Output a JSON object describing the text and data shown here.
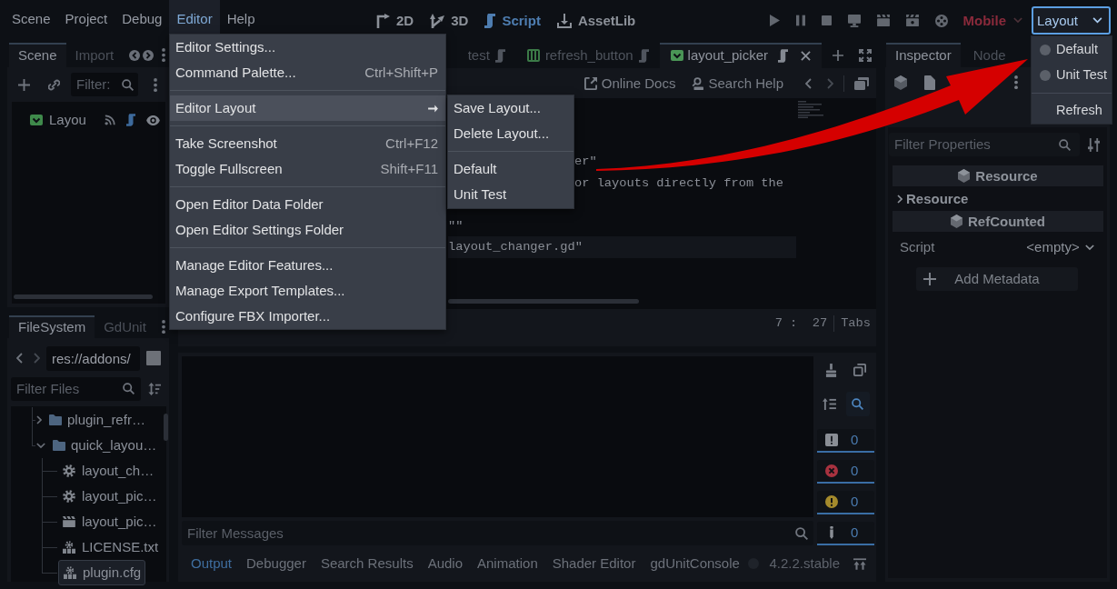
{
  "menu_bar": {
    "menus": [
      {
        "label": "Scene",
        "selected": false
      },
      {
        "label": "Project",
        "selected": false
      },
      {
        "label": "Debug",
        "selected": false
      },
      {
        "label": "Editor",
        "selected": true
      },
      {
        "label": "Help",
        "selected": false
      }
    ]
  },
  "main_screens": [
    {
      "label": "2D",
      "kind": "canvas",
      "selected": false
    },
    {
      "label": "3D",
      "kind": "spatial",
      "selected": false
    },
    {
      "label": "Script",
      "kind": "script",
      "selected": true
    },
    {
      "label": "AssetLib",
      "kind": "assetlib",
      "selected": false
    }
  ],
  "run_bar": {
    "renderer": "Mobile"
  },
  "layout_picker": {
    "value": "Layout",
    "options": [
      {
        "label": "Default",
        "selected": false
      },
      {
        "label": "Unit Test",
        "selected": false
      }
    ],
    "actions": [
      "Refresh"
    ]
  },
  "editor_menu": {
    "sections": [
      {
        "items": [
          {
            "label": "Editor Settings...",
            "selected": false
          },
          {
            "label": "Command Palette...",
            "shortcut": "Ctrl+Shift+P",
            "selected": false
          }
        ]
      },
      {
        "items": [
          {
            "label": "Editor Layout",
            "submenu": true,
            "selected": true
          }
        ]
      },
      {
        "items": [
          {
            "label": "Take Screenshot",
            "shortcut": "Ctrl+F12",
            "selected": false
          },
          {
            "label": "Toggle Fullscreen",
            "shortcut": "Shift+F11",
            "selected": false
          }
        ]
      },
      {
        "items": [
          {
            "label": "Open Editor Data Folder",
            "selected": false
          },
          {
            "label": "Open Editor Settings Folder",
            "selected": false
          }
        ]
      },
      {
        "items": [
          {
            "label": "Manage Editor Features...",
            "selected": false
          },
          {
            "label": "Manage Export Templates...",
            "selected": false
          },
          {
            "label": "Configure FBX Importer...",
            "selected": false
          }
        ]
      }
    ]
  },
  "layout_submenu": {
    "sections": [
      {
        "items": [
          {
            "label": "Save Layout...",
            "selected": false
          },
          {
            "label": "Delete Layout...",
            "selected": false
          }
        ]
      },
      {
        "items": [
          {
            "label": "Default",
            "selected": false
          },
          {
            "label": "Unit Test",
            "selected": false
          }
        ]
      }
    ]
  },
  "scene_dock": {
    "tabs": [
      {
        "label": "Scene",
        "selected": true
      },
      {
        "label": "Import",
        "selected": false
      }
    ],
    "filter": {
      "placeholder": "Filter:"
    },
    "tree": [
      {
        "label": "Layou"
      }
    ]
  },
  "filesystem_dock": {
    "tabs": [
      {
        "label": "FileSystem",
        "selected": true
      },
      {
        "label": "GdUnit",
        "selected": false
      }
    ],
    "path": "res://addons/",
    "filter": {
      "placeholder": "Filter Files"
    },
    "tree": [
      {
        "label": "plugin_refr…",
        "kind": "folder",
        "expanded": false,
        "selected": false
      },
      {
        "label": "quick_layou…",
        "kind": "folder",
        "expanded": true,
        "selected": false,
        "children": [
          {
            "label": "layout_ch…",
            "kind": "script",
            "selected": false
          },
          {
            "label": "layout_pic…",
            "kind": "script",
            "selected": false
          },
          {
            "label": "layout_pic…",
            "kind": "scene",
            "selected": false
          },
          {
            "label": "LICENSE.txt",
            "kind": "text",
            "selected": false
          },
          {
            "label": "plugin.cfg",
            "kind": "text",
            "selected": true
          }
        ]
      }
    ]
  },
  "script_editor": {
    "tabs": [
      {
        "label": "test",
        "kind": "script",
        "selected": false
      },
      {
        "label": "refresh_button",
        "kind": "container",
        "selected": false
      },
      {
        "label": "layout_picker",
        "kind": "option",
        "selected": true
      }
    ],
    "toolbar": [
      {
        "label": "Online Docs",
        "kind": "docs"
      },
      {
        "label": "Search Help",
        "kind": "help"
      }
    ],
    "code": [
      {
        "text": "er\"",
        "current": false
      },
      {
        "text": "or layouts directly from the",
        "current": false
      },
      {
        "text": "\"\"",
        "current": false
      },
      {
        "text": "layout_changer.gd\"",
        "current": true
      }
    ],
    "cursor": "7 :  27",
    "indent": "Tabs"
  },
  "output_panel": {
    "search_toggle": {
      "on": true
    },
    "counters": [
      {
        "kind": "log",
        "count": "0",
        "on": true
      },
      {
        "kind": "error",
        "count": "0",
        "on": true
      },
      {
        "kind": "warning",
        "count": "0",
        "on": true
      },
      {
        "kind": "editor",
        "count": "0",
        "on": true
      }
    ],
    "filter": {
      "placeholder": "Filter Messages"
    }
  },
  "bottom_panel": {
    "tabs": [
      {
        "label": "Output",
        "selected": true
      },
      {
        "label": "Debugger",
        "selected": false
      },
      {
        "label": "Search Results",
        "selected": false
      },
      {
        "label": "Audio",
        "selected": false
      },
      {
        "label": "Animation",
        "selected": false
      },
      {
        "label": "Shader Editor",
        "selected": false
      },
      {
        "label": "gdUnitConsole",
        "selected": false
      }
    ],
    "version": "4.2.2.stable"
  },
  "inspector_dock": {
    "tabs": [
      {
        "label": "Inspector",
        "selected": true
      },
      {
        "label": "Node",
        "selected": false
      }
    ],
    "filter": {
      "placeholder": "Filter Properties"
    },
    "sections": [
      {
        "kind": "category",
        "label": "Resource"
      },
      {
        "kind": "group",
        "label": "Resource",
        "expanded": false
      },
      {
        "kind": "category",
        "label": "RefCounted"
      },
      {
        "kind": "property",
        "label": "Script",
        "value": "<empty>"
      }
    ],
    "add_button": "Add Metadata"
  }
}
